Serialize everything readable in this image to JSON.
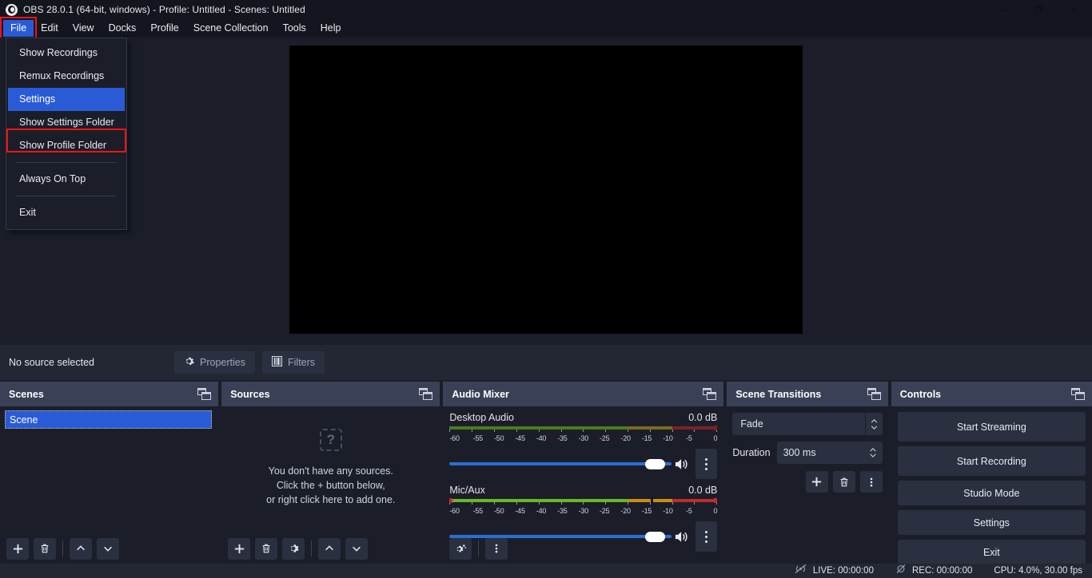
{
  "window": {
    "title": "OBS 28.0.1 (64-bit, windows) - Profile: Untitled - Scenes: Untitled",
    "logo_icon": "obs-logo-icon",
    "minimize_icon": "minimize-icon",
    "maximize_icon": "maximize-icon",
    "close_icon": "close-icon"
  },
  "menubar": {
    "items": [
      {
        "label": "File",
        "active": true
      },
      {
        "label": "Edit",
        "active": false
      },
      {
        "label": "View",
        "active": false
      },
      {
        "label": "Docks",
        "active": false
      },
      {
        "label": "Profile",
        "active": false
      },
      {
        "label": "Scene Collection",
        "active": false
      },
      {
        "label": "Tools",
        "active": false
      },
      {
        "label": "Help",
        "active": false
      }
    ]
  },
  "file_menu": {
    "items": [
      {
        "label": "Show Recordings",
        "selected": false
      },
      {
        "label": "Remux Recordings",
        "selected": false
      },
      {
        "label": "Settings",
        "selected": true
      },
      {
        "label": "Show Settings Folder",
        "selected": false
      },
      {
        "label": "Show Profile Folder",
        "selected": false
      },
      {
        "label": "Always On Top",
        "selected": false
      },
      {
        "label": "Exit",
        "selected": false
      }
    ]
  },
  "source_toolbar": {
    "status": "No source selected",
    "properties_label": "Properties",
    "properties_icon": "gear-icon",
    "filters_label": "Filters",
    "filters_icon": "filters-icon"
  },
  "scenes": {
    "title": "Scenes",
    "float_icon": "undock-icon",
    "items": [
      {
        "name": "Scene"
      }
    ],
    "toolbar": [
      {
        "icon": "plus-icon",
        "name": "add-scene-button"
      },
      {
        "icon": "trash-icon",
        "name": "remove-scene-button"
      },
      {
        "icon": "chevron-up-icon",
        "name": "move-scene-up-button"
      },
      {
        "icon": "chevron-down-icon",
        "name": "move-scene-down-button"
      }
    ]
  },
  "sources": {
    "title": "Sources",
    "float_icon": "undock-icon",
    "placeholder_icon": "question-mark-icon",
    "empty_line1": "You don't have any sources.",
    "empty_line2": "Click the + button below,",
    "empty_line3": "or right click here to add one.",
    "toolbar": [
      {
        "icon": "plus-icon",
        "name": "add-source-button"
      },
      {
        "icon": "trash-icon",
        "name": "remove-source-button"
      },
      {
        "icon": "gear-icon",
        "name": "source-properties-button"
      },
      {
        "icon": "chevron-up-icon",
        "name": "move-source-up-button"
      },
      {
        "icon": "chevron-down-icon",
        "name": "move-source-down-button"
      }
    ]
  },
  "audio_mixer": {
    "title": "Audio Mixer",
    "float_icon": "undock-icon",
    "scale_labels": [
      "-60",
      "-55",
      "-50",
      "-45",
      "-40",
      "-35",
      "-30",
      "-25",
      "-20",
      "-15",
      "-10",
      "-5",
      "0"
    ],
    "channels": [
      {
        "name": "Desktop Audio",
        "db": "0.0 dB",
        "active": false,
        "volume_percent": 100,
        "mute_icon": "speaker-icon",
        "menu_icon": "kebab-icon"
      },
      {
        "name": "Mic/Aux",
        "db": "0.0 dB",
        "active": true,
        "volume_percent": 100,
        "mute_icon": "speaker-icon",
        "menu_icon": "kebab-icon"
      }
    ],
    "toolbar": [
      {
        "icon": "audio-settings-icon",
        "name": "audio-advanced-properties-button"
      },
      {
        "icon": "kebab-icon",
        "name": "mixer-menu-button"
      }
    ]
  },
  "scene_transitions": {
    "title": "Scene Transitions",
    "float_icon": "undock-icon",
    "transition": "Fade",
    "duration_label": "Duration",
    "duration_value": "300 ms",
    "toolbar": [
      {
        "icon": "plus-icon",
        "name": "add-transition-button"
      },
      {
        "icon": "trash-icon",
        "name": "remove-transition-button"
      },
      {
        "icon": "kebab-icon",
        "name": "transition-properties-button"
      }
    ]
  },
  "controls": {
    "title": "Controls",
    "float_icon": "undock-icon",
    "buttons": [
      {
        "label": "Start Streaming"
      },
      {
        "label": "Start Recording"
      },
      {
        "label": "Studio Mode"
      },
      {
        "label": "Settings"
      },
      {
        "label": "Exit"
      }
    ]
  },
  "statusbar": {
    "live_icon": "live-disabled-icon",
    "live": "LIVE: 00:00:00",
    "rec_icon": "rec-disabled-icon",
    "rec": "REC: 00:00:00",
    "cpu": "CPU: 4.0%, 30.00 fps"
  },
  "colors": {
    "accent_blue": "#2a5bd7",
    "annotation_red": "#f01414",
    "panel_bg": "#1b1e29",
    "header_bg": "#3a4055",
    "button_bg": "#2b3040",
    "meter_green": "#6eb52a",
    "meter_yellow": "#c98f13",
    "meter_red": "#bf2b2f"
  }
}
